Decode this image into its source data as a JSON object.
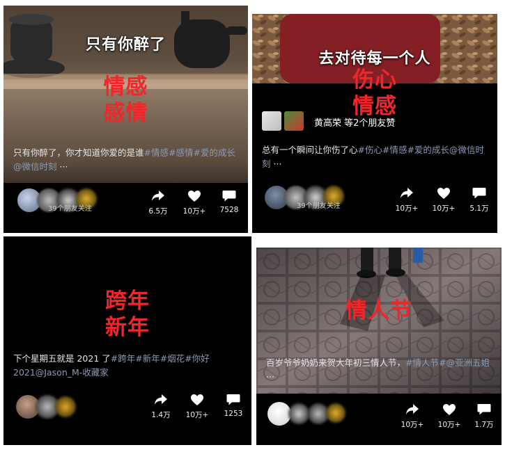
{
  "cards": [
    {
      "caption": "只有你醉了",
      "tag_lines": [
        "情感",
        "感情"
      ],
      "desc_plain": "只有你醉了，你才知道你爱的是谁",
      "desc_tags": "#情感#感情#爱的成长@微信时刻",
      "desc_more": "···",
      "friends_text": "39个朋友关注",
      "share_count": "6.5万",
      "like_count": "10万+",
      "comment_count": "7528"
    },
    {
      "caption": "去对待每一个人",
      "tag_lines": [
        "伤心",
        "情感"
      ],
      "likers_text": "黄高荣 等2个朋友赞",
      "desc_plain": "总有一个瞬间让你伤了心",
      "desc_tags": "#伤心#情感#爱的成长@微信时刻",
      "desc_more": "···",
      "friends_text": "39个朋友关注",
      "share_count": "10万+",
      "like_count": "10万+",
      "comment_count": "5.1万"
    },
    {
      "tag_lines": [
        "跨年",
        "新年"
      ],
      "desc_plain": "下个星期五就是 2021 了",
      "desc_tags": "#跨年#新年#烟花#你好 2021@Jason_M-收藏家",
      "share_count": "1.4万",
      "like_count": "10万+",
      "comment_count": "1253"
    },
    {
      "tag_lines": [
        "情人节"
      ],
      "desc_plain": "百岁爷爷奶奶来贺大年初三情人节，",
      "desc_tags": "#情人节#@亚洲五姐",
      "desc_more": "···",
      "share_count": "10万+",
      "like_count": "10万+",
      "comment_count": "1.7万"
    }
  ]
}
